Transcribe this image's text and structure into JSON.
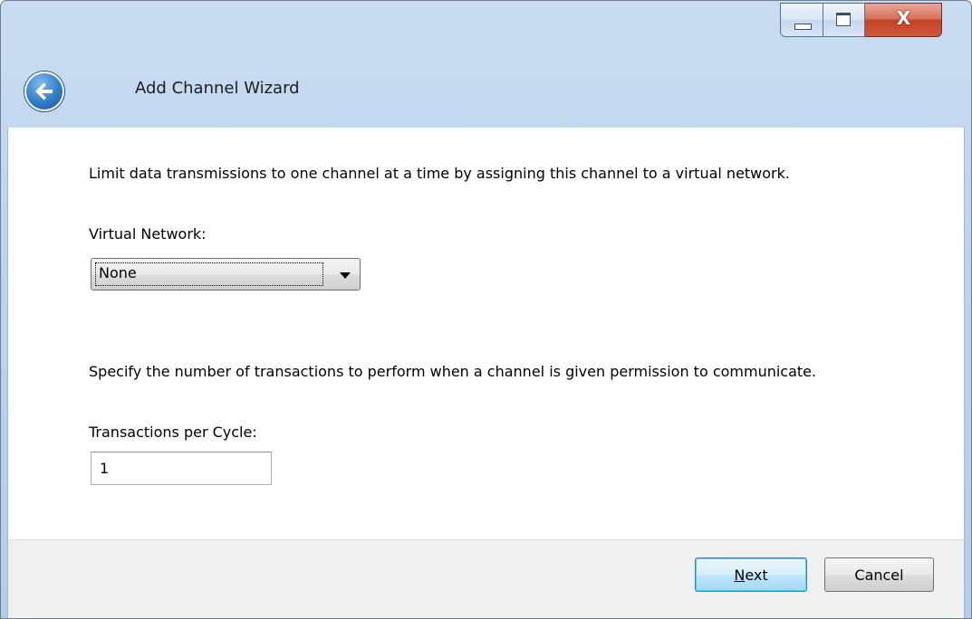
{
  "window": {
    "title": "Add Channel Wizard",
    "controls": {
      "close_glyph": "X"
    }
  },
  "virtual_network": {
    "description": "Limit data transmissions to one channel at a time by assigning this channel to a virtual network.",
    "label": "Virtual Network:",
    "selected": "None"
  },
  "transactions": {
    "description": "Specify the number of transactions to perform when a channel is given permission to communicate.",
    "label": "Transactions per Cycle:",
    "value": "1"
  },
  "buttons": {
    "next_mnemonic": "N",
    "next_rest": "ext",
    "cancel": "Cancel"
  },
  "icons": {
    "back": "back-arrow-icon",
    "minimize": "minimize-icon",
    "maximize": "maximize-icon",
    "close": "close-icon",
    "dropdown": "chevron-down-icon"
  },
  "colors": {
    "titlebar": "#bcd3ee",
    "close_button": "#c24426",
    "default_button_border": "#3c7fb1"
  }
}
